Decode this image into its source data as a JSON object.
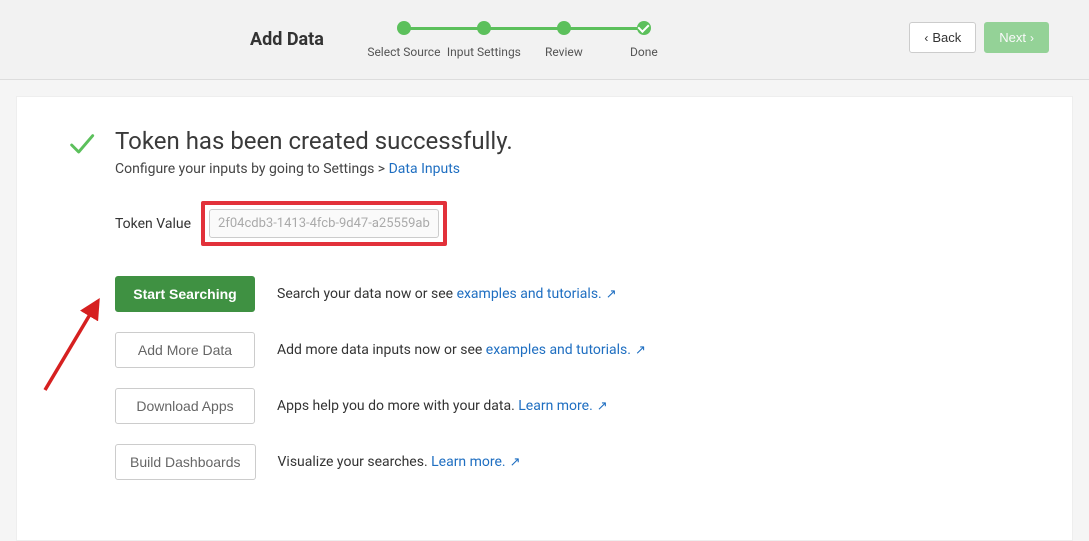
{
  "header": {
    "title": "Add Data",
    "steps": [
      {
        "label": "Select Source",
        "done": true
      },
      {
        "label": "Input Settings",
        "done": true
      },
      {
        "label": "Review",
        "done": true
      },
      {
        "label": "Done",
        "done": true
      }
    ],
    "back_label": "Back",
    "next_label": "Next"
  },
  "success": {
    "title": "Token has been created successfully.",
    "subtitle_prefix": "Configure your inputs by going to Settings > ",
    "subtitle_link": "Data Inputs",
    "token_label": "Token Value",
    "token_value": "2f04cdb3-1413-4fcb-9d47-a25559ab"
  },
  "actions": [
    {
      "button": "Start Searching",
      "primary": true,
      "desc_prefix": "Search your data now or see ",
      "desc_link": "examples and tutorials."
    },
    {
      "button": "Add More Data",
      "primary": false,
      "desc_prefix": "Add more data inputs now or see ",
      "desc_link": "examples and tutorials."
    },
    {
      "button": "Download Apps",
      "primary": false,
      "desc_prefix": "Apps help you do more with your data. ",
      "desc_link": "Learn more."
    },
    {
      "button": "Build Dashboards",
      "primary": false,
      "desc_prefix": "Visualize your searches. ",
      "desc_link": "Learn more."
    }
  ]
}
